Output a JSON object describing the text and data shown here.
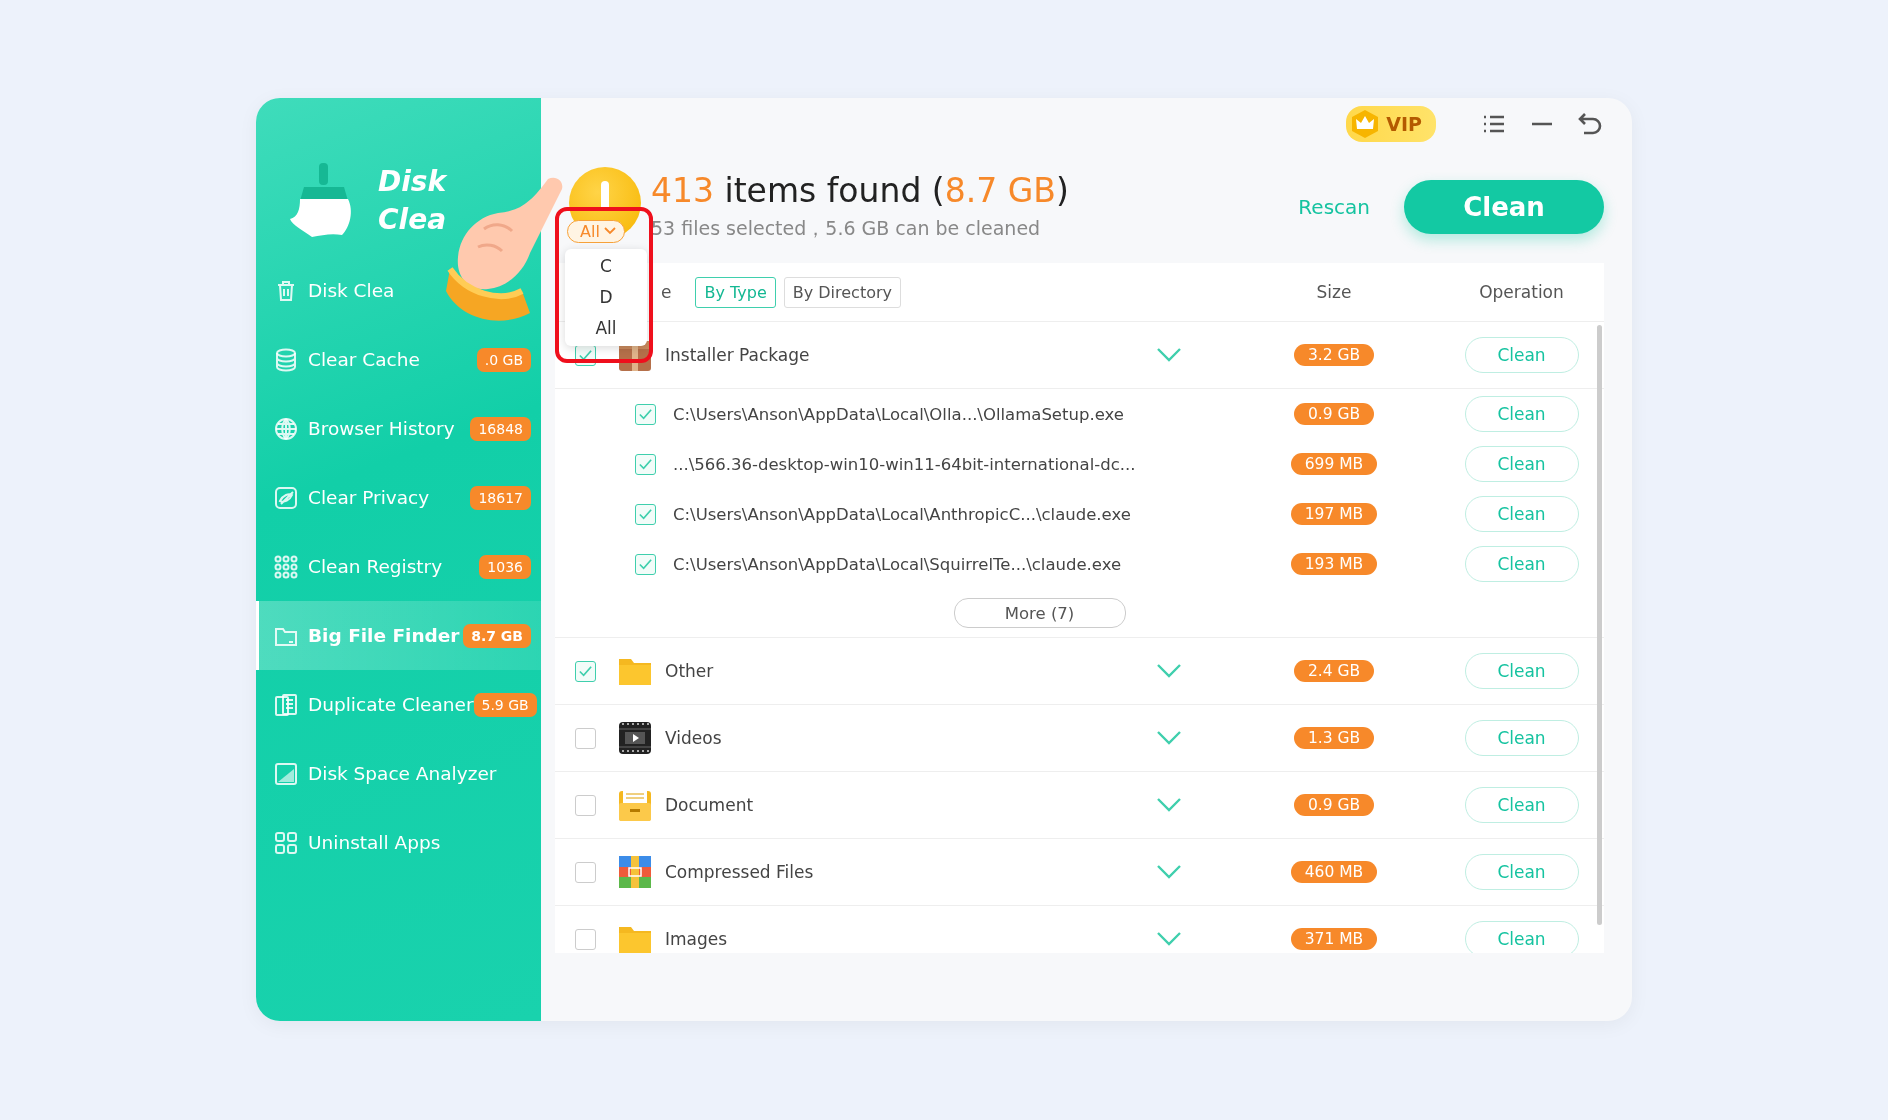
{
  "sidebar": {
    "logo": {
      "line_1": "Disk",
      "line_2": "Clea"
    },
    "items": [
      {
        "kind": "trash",
        "label": "Disk Clea",
        "selected": false
      },
      {
        "kind": "stack",
        "label": "Clear Cache",
        "badge": ".0 GB",
        "selected": false
      },
      {
        "kind": "globe",
        "label": "Browser History",
        "badge": "16848",
        "selected": false
      },
      {
        "kind": "privacy",
        "label": "Clear Privacy",
        "badge": "18617",
        "selected": false
      },
      {
        "kind": "dots",
        "label": "Clean Registry",
        "badge": "1036",
        "selected": false
      },
      {
        "kind": "folder",
        "label": "Big File Finder",
        "badge": "8.7 GB",
        "selected": true
      },
      {
        "kind": "docs",
        "label": "Duplicate Cleaner",
        "badge": "5.9 GB",
        "selected": false
      },
      {
        "kind": "chart",
        "label": "Disk Space Analyzer",
        "selected": false
      },
      {
        "kind": "apps",
        "label": "Uninstall Apps",
        "selected": false
      }
    ]
  },
  "top_bar": {
    "vip": "VIP"
  },
  "header": {
    "count": "413",
    "title": "items found",
    "paren_open": "(",
    "size": "8.7 GB",
    "paren_close": ")",
    "subtitle": "53 files selected，5.6 GB can be cleaned",
    "rescan": "Rescan",
    "clean": "Clean"
  },
  "drive_dropdown": {
    "value": "All",
    "expanded": true,
    "options": [
      "C",
      "D",
      "All"
    ]
  },
  "table": {
    "column_1": "e",
    "view_tabs": [
      {
        "label": "By Type",
        "selected": true
      },
      {
        "label": "By Directory",
        "selected": false
      }
    ],
    "size_column": "Size",
    "operation_column": "Operation",
    "groups": [
      {
        "kind": "installer",
        "name": "Installer Package",
        "checked": true,
        "size": "3.2 GB",
        "action": "Clean",
        "more": "More (7)",
        "children": [
          {
            "path": "C:\\Users\\Anson\\AppData\\Local\\Olla...\\OllamaSetup.exe",
            "checked": true,
            "size": "0.9 GB",
            "action": "Clean"
          },
          {
            "path": "...\\566.36-desktop-win10-win11-64bit-international-dc...",
            "checked": true,
            "size": "699 MB",
            "action": "Clean"
          },
          {
            "path": "C:\\Users\\Anson\\AppData\\Local\\AnthropicC...\\claude.exe",
            "checked": true,
            "size": "197 MB",
            "action": "Clean"
          },
          {
            "path": "C:\\Users\\Anson\\AppData\\Local\\SquirrelTe...\\claude.exe",
            "checked": true,
            "size": "193 MB",
            "action": "Clean"
          }
        ]
      },
      {
        "kind": "folder",
        "name": "Other",
        "checked": true,
        "size": "2.4 GB",
        "action": "Clean"
      },
      {
        "kind": "video",
        "name": "Videos",
        "checked": false,
        "size": "1.3 GB",
        "action": "Clean"
      },
      {
        "kind": "document",
        "name": "Document",
        "checked": false,
        "size": "0.9 GB",
        "action": "Clean"
      },
      {
        "kind": "archive",
        "name": "Compressed Files",
        "checked": false,
        "size": "460 MB",
        "action": "Clean"
      },
      {
        "kind": "folder",
        "name": "Images",
        "checked": false,
        "size": "371 MB",
        "action": "Clean"
      }
    ]
  }
}
